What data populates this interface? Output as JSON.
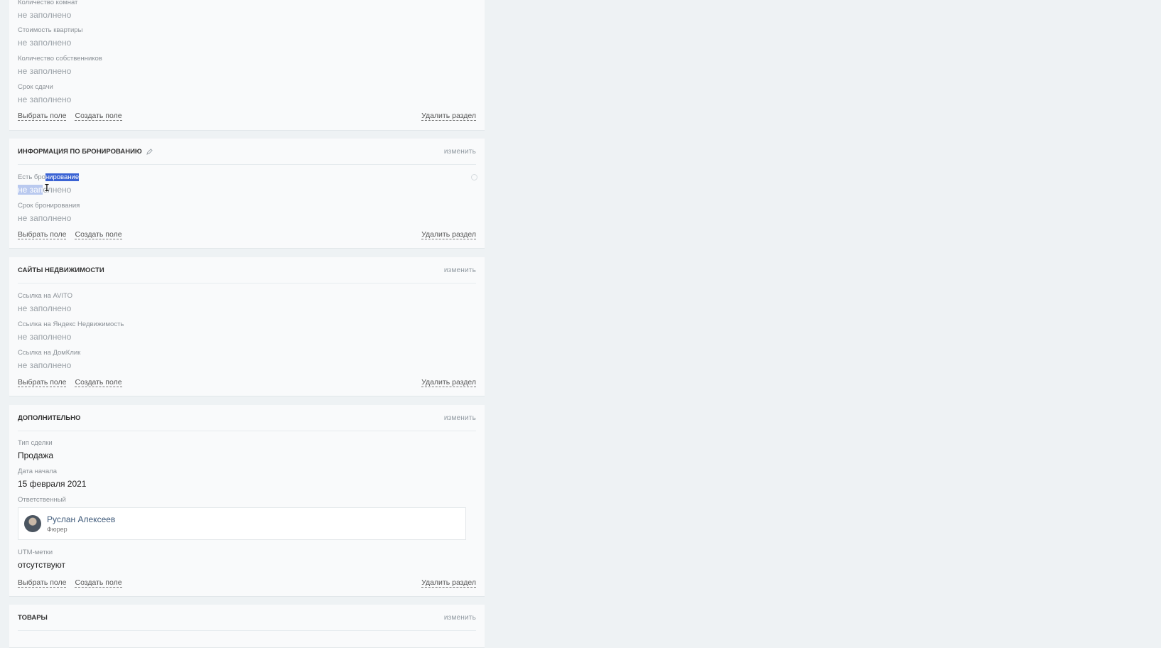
{
  "sections": {
    "apartment": {
      "fields": [
        {
          "label": "Количество комнат",
          "value": "не заполнено"
        },
        {
          "label": "Стоимость квартиры",
          "value": "не заполнено"
        },
        {
          "label": "Количество собственников",
          "value": "не заполнено"
        },
        {
          "label": "Срок сдачи",
          "value": "не заполнено"
        }
      ],
      "footer": {
        "select": "Выбрать поле",
        "create": "Создать поле",
        "delete": "Удалить раздел"
      }
    },
    "booking": {
      "title": "ИНФОРМАЦИЯ ПО БРОНИРОВАНИЮ",
      "change": "изменить",
      "fields": [
        {
          "label_pre": "Есть бро",
          "label_sel": "нирование",
          "value_sel": "не зап",
          "value_post": "олнено"
        },
        {
          "label": "Срок бронирования",
          "value": "не заполнено"
        }
      ],
      "footer": {
        "select": "Выбрать поле",
        "create": "Создать поле",
        "delete": "Удалить раздел"
      }
    },
    "realty_sites": {
      "title": "САЙТЫ НЕДВИЖИМОСТИ",
      "change": "изменить",
      "fields": [
        {
          "label": "Ссылка на AVITO",
          "value": "не заполнено"
        },
        {
          "label": "Ссылка на Яндекс Недвижимость",
          "value": "не заполнено"
        },
        {
          "label": "Ссылка на ДомКлик",
          "value": "не заполнено"
        }
      ],
      "footer": {
        "select": "Выбрать поле",
        "create": "Создать поле",
        "delete": "Удалить раздел"
      }
    },
    "additional": {
      "title": "ДОПОЛНИТЕЛЬНО",
      "change": "изменить",
      "fields": [
        {
          "label": "Тип сделки",
          "value": "Продажа"
        },
        {
          "label": "Дата начала",
          "value": "15 февраля 2021"
        },
        {
          "label": "Ответственный"
        },
        {
          "label": "UTM-метки",
          "value": "отсутствуют"
        }
      ],
      "responsible": {
        "name": "Руслан Алексеев",
        "role": "Фюрер"
      },
      "footer": {
        "select": "Выбрать поле",
        "create": "Создать поле",
        "delete": "Удалить раздел"
      }
    },
    "goods": {
      "title": "ТОВАРЫ",
      "change": "изменить"
    }
  }
}
